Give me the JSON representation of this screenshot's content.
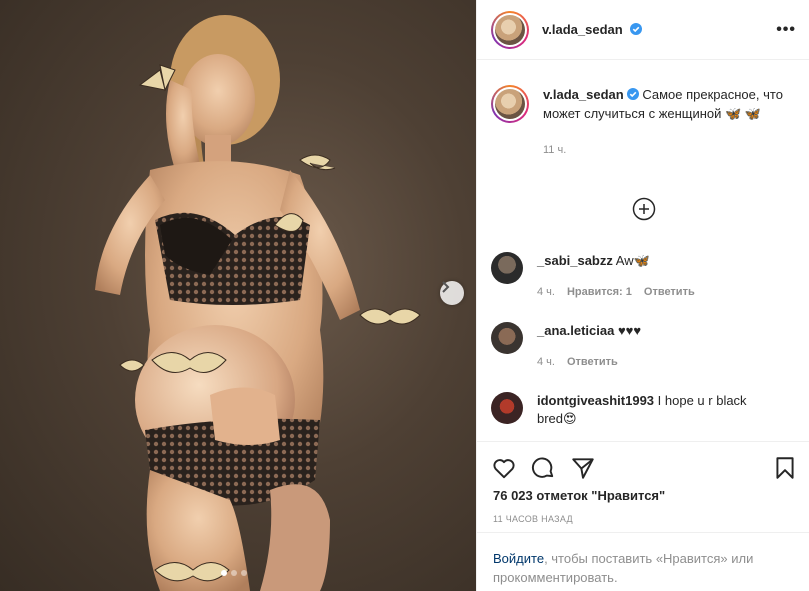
{
  "post": {
    "username": "v.lada_sedan",
    "caption": "Самое прекрасное, что может случиться с женщиной 🦋 🦋",
    "caption_time": "11 ч.",
    "likes_text": "76 023 отметок \"Нравится\"",
    "posted_ago": "11 ЧАСОВ НАЗАД"
  },
  "comments": [
    {
      "username": "_sabi_sabzz",
      "text": "Aw🦋",
      "time": "4 ч.",
      "likes": "Нравится: 1",
      "reply": "Ответить"
    },
    {
      "username": "_ana.leticiaa",
      "text": "♥♥♥",
      "time": "4 ч.",
      "reply": "Ответить"
    },
    {
      "username": "idontgiveashit1993",
      "text": "I hope u r black bred😍"
    }
  ],
  "login_prompt": {
    "link": "Войдите",
    "text": ", чтобы поставить «Нравится» или прокомментировать."
  },
  "carousel": {
    "current": 1,
    "total": 3
  },
  "icons": {
    "verified": "verified-badge-icon",
    "more": "more-options-icon",
    "load_more": "plus-circle-icon",
    "like": "heart-icon",
    "comment": "comment-icon",
    "share": "paper-plane-icon",
    "save": "bookmark-icon",
    "next": "chevron-right-icon"
  },
  "colors": {
    "verified": "#3897f0",
    "link": "#00376b",
    "muted": "#8e8e8e"
  }
}
